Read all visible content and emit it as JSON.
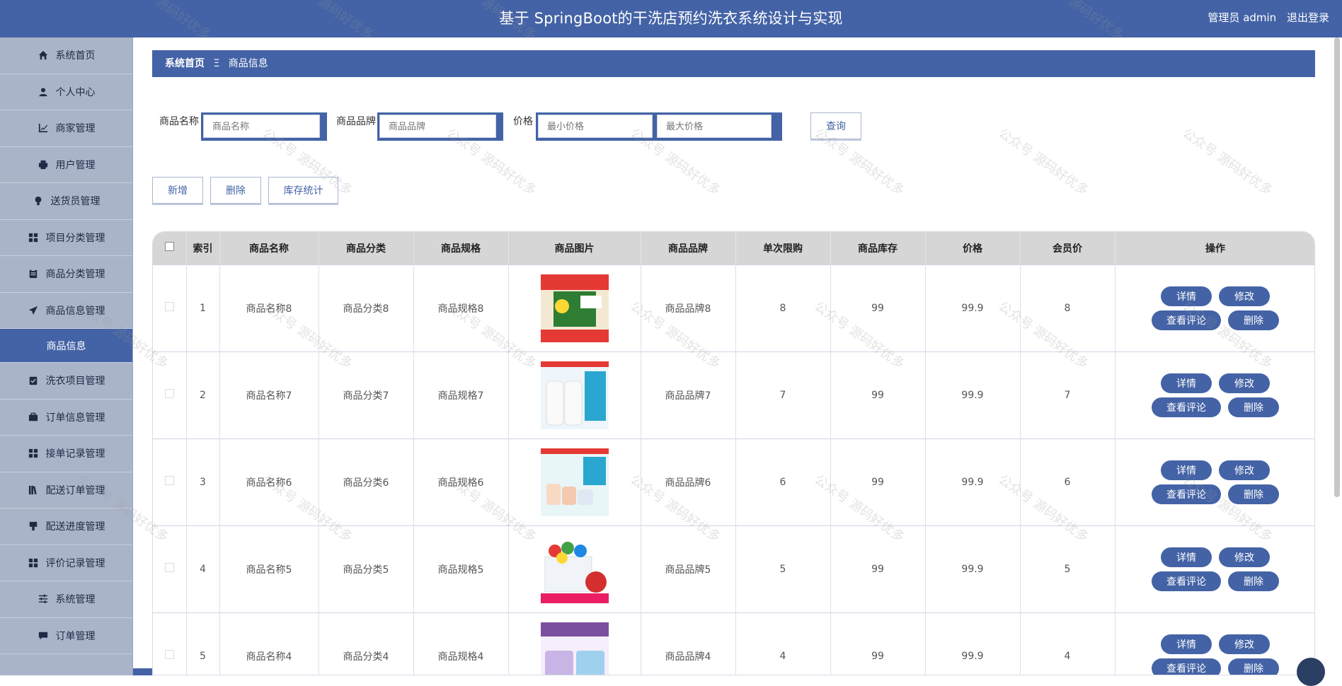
{
  "header": {
    "title": "基于 SpringBoot的干洗店预约洗衣系统设计与实现",
    "user_label": "管理员 admin",
    "logout": "退出登录"
  },
  "sidebar": {
    "items": [
      {
        "label": "系统首页",
        "icon": "home-icon"
      },
      {
        "label": "个人中心",
        "icon": "user-icon"
      },
      {
        "label": "商家管理",
        "icon": "chart-icon"
      },
      {
        "label": "用户管理",
        "icon": "printer-icon"
      },
      {
        "label": "送货员管理",
        "icon": "bulb-icon"
      },
      {
        "label": "项目分类管理",
        "icon": "grid-icon"
      },
      {
        "label": "商品分类管理",
        "icon": "clipboard-icon"
      },
      {
        "label": "商品信息管理",
        "icon": "send-icon"
      },
      {
        "label": "商品信息",
        "icon": ""
      },
      {
        "label": "洗衣项目管理",
        "icon": "clipboard-check-icon"
      },
      {
        "label": "订单信息管理",
        "icon": "briefcase-icon"
      },
      {
        "label": "接单记录管理",
        "icon": "grid-icon"
      },
      {
        "label": "配送订单管理",
        "icon": "book-icon"
      },
      {
        "label": "配送进度管理",
        "icon": "stamp-icon"
      },
      {
        "label": "评价记录管理",
        "icon": "grid-icon"
      },
      {
        "label": "系统管理",
        "icon": "sliders-icon"
      },
      {
        "label": "订单管理",
        "icon": "comment-icon"
      }
    ]
  },
  "breadcrumb": {
    "home": "系统首页",
    "sep": "Ξ",
    "current": "商品信息"
  },
  "search": {
    "name_label": "商品名称",
    "name_placeholder": "商品名称",
    "brand_label": "商品品牌",
    "brand_placeholder": "商品品牌",
    "price_label": "价格",
    "min_placeholder": "最小价格",
    "max_placeholder": "最大价格",
    "query": "查询"
  },
  "actions": {
    "add": "新增",
    "delete": "删除",
    "stats": "库存统计"
  },
  "table": {
    "headers": [
      "索引",
      "商品名称",
      "商品分类",
      "商品规格",
      "商品图片",
      "商品品牌",
      "单次限购",
      "商品库存",
      "价格",
      "会员价",
      "操作"
    ],
    "rows": [
      {
        "index": "1",
        "name": "商品名称8",
        "category": "商品分类8",
        "spec": "商品规格8",
        "brand": "商品品牌8",
        "limit": "8",
        "stock": "99",
        "price": "99.9",
        "member": "8"
      },
      {
        "index": "2",
        "name": "商品名称7",
        "category": "商品分类7",
        "spec": "商品规格7",
        "brand": "商品品牌7",
        "limit": "7",
        "stock": "99",
        "price": "99.9",
        "member": "7"
      },
      {
        "index": "3",
        "name": "商品名称6",
        "category": "商品分类6",
        "spec": "商品规格6",
        "brand": "商品品牌6",
        "limit": "6",
        "stock": "99",
        "price": "99.9",
        "member": "6"
      },
      {
        "index": "4",
        "name": "商品名称5",
        "category": "商品分类5",
        "spec": "商品规格5",
        "brand": "商品品牌5",
        "limit": "5",
        "stock": "99",
        "price": "99.9",
        "member": "5"
      },
      {
        "index": "5",
        "name": "商品名称4",
        "category": "商品分类4",
        "spec": "商品规格4",
        "brand": "商品品牌4",
        "limit": "4",
        "stock": "99",
        "price": "99.9",
        "member": "4"
      }
    ],
    "ops": {
      "detail": "详情",
      "edit": "修改",
      "reviews": "查看评论",
      "remove": "删除"
    }
  },
  "watermark": "公众号 源码好优多",
  "colors": {
    "primary": "#4463a6",
    "sidebar": "#aab4c9",
    "table_head": "#d6d6d6"
  }
}
